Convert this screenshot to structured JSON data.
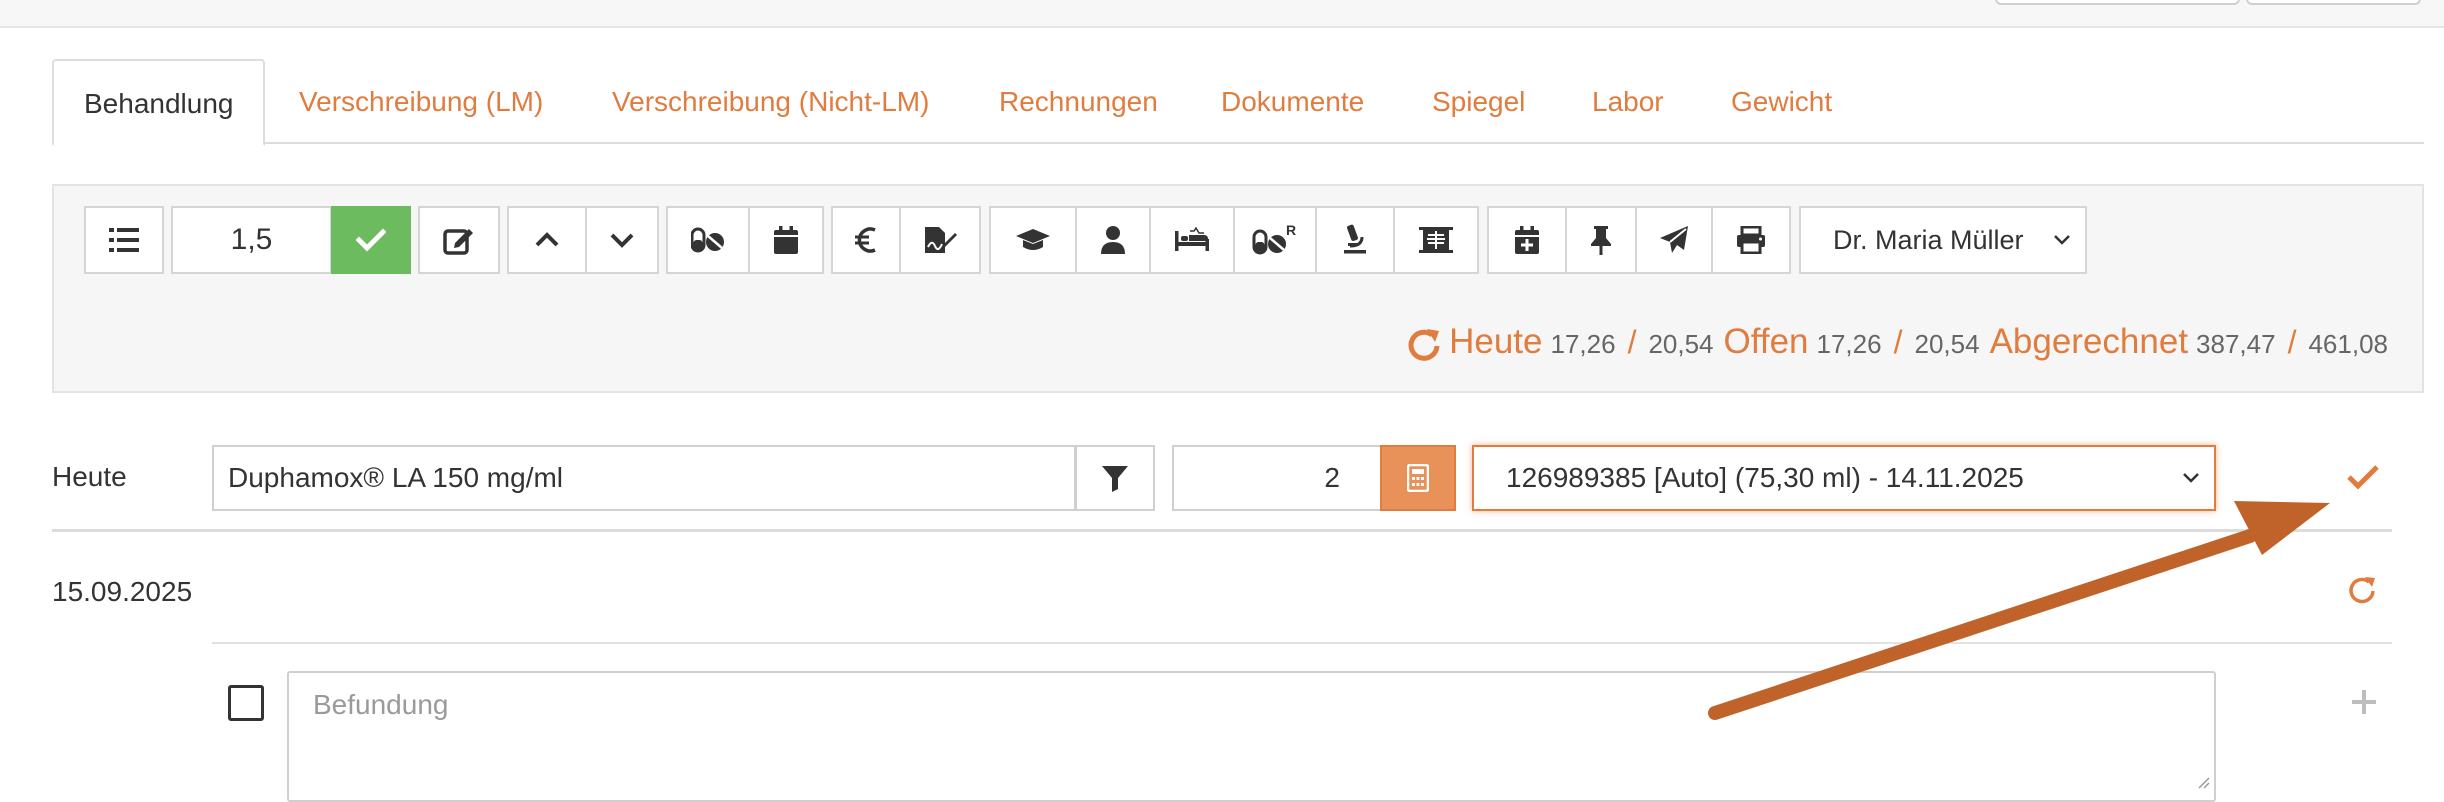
{
  "tabs": [
    {
      "label": "Behandlung",
      "active": true
    },
    {
      "label": "Verschreibung (LM)",
      "active": false
    },
    {
      "label": "Verschreibung (Nicht-LM)",
      "active": false
    },
    {
      "label": "Rechnungen",
      "active": false
    },
    {
      "label": "Dokumente",
      "active": false
    },
    {
      "label": "Spiegel",
      "active": false
    },
    {
      "label": "Labor",
      "active": false
    },
    {
      "label": "Gewicht",
      "active": false
    }
  ],
  "toolbar": {
    "quantity_value": "1,5",
    "vet_selected": "Dr. Maria Müller",
    "icons": [
      "list-icon",
      "check-icon",
      "edit-icon",
      "chevron-up-icon",
      "chevron-down-icon",
      "pills-icon",
      "calendar-icon",
      "euro-icon",
      "signature-icon",
      "graduation-cap-icon",
      "person-icon",
      "bed-icon",
      "prescription-pills-icon",
      "microscope-icon",
      "xray-icon",
      "calendar-plus-icon",
      "pin-icon",
      "send-icon",
      "print-icon"
    ]
  },
  "totals": {
    "heute_label": "Heute",
    "heute_net": "17,26",
    "heute_gross": "20,54",
    "offen_label": "Offen",
    "offen_net": "17,26",
    "offen_gross": "20,54",
    "abgerechnet_label": "Abgerechnet",
    "abgerechnet_net": "387,47",
    "abgerechnet_gross": "461,08",
    "separator": "/"
  },
  "entry": {
    "date_label": "Heute",
    "product": "Duphamox® LA 150 mg/ml",
    "amount": "2",
    "batch": "126989385 [Auto] (75,30 ml) - 14.11.2025"
  },
  "history": {
    "date": "15.09.2025",
    "finding_placeholder": "Befundung"
  },
  "colors": {
    "accent": "#e07c3e",
    "success": "#6dbb5f",
    "arrow": "#c0632a"
  }
}
